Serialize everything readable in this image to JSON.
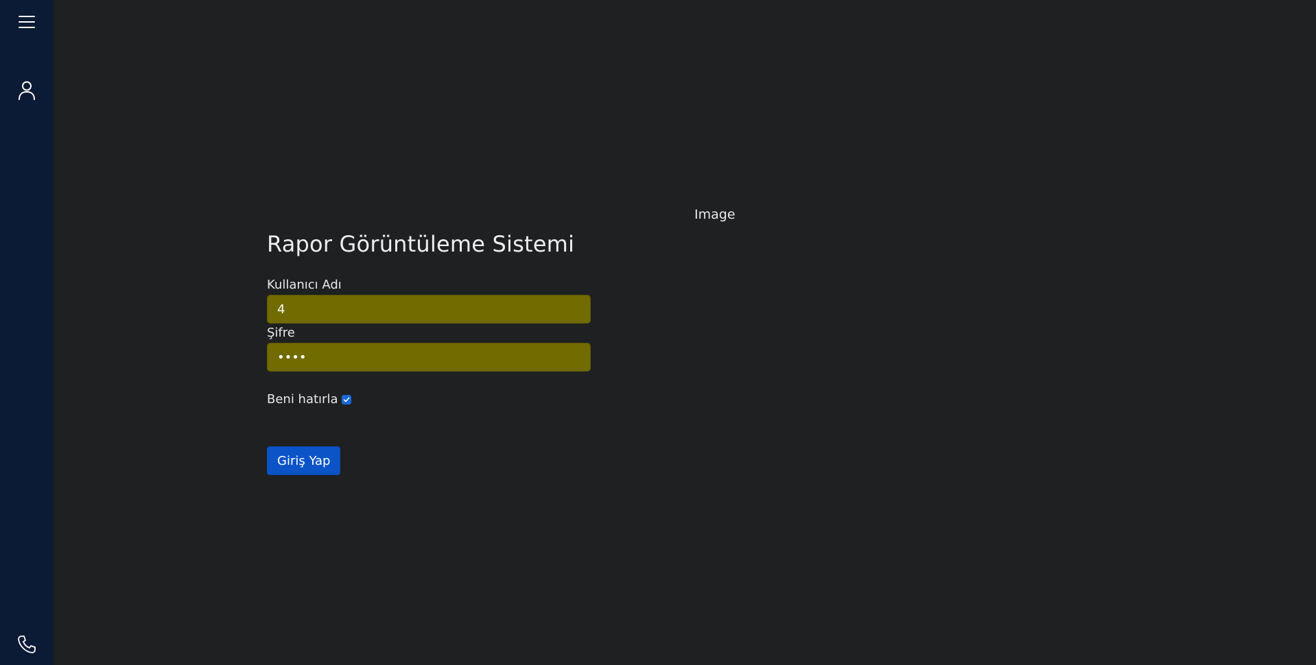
{
  "sidebar": {
    "items": [
      {
        "name": "menu",
        "icon": "hamburger-menu-icon"
      },
      {
        "name": "profile",
        "icon": "user-icon"
      },
      {
        "name": "contact",
        "icon": "phone-icon"
      }
    ]
  },
  "header_image": {
    "alt_text": "Image"
  },
  "login": {
    "title": "Rapor Görüntüleme Sistemi",
    "username_label": "Kullanıcı Adı",
    "username_value": "4",
    "password_label": "Şifre",
    "password_value": "••••",
    "remember_label": "Beni hatırla",
    "remember_checked": true,
    "submit_label": "Giriş Yap"
  },
  "colors": {
    "background": "#1f2022",
    "sidebar": "#0c1b35",
    "input_autofill": "#716b00",
    "primary_button": "#0b54c8",
    "checkbox": "#1768d6"
  }
}
